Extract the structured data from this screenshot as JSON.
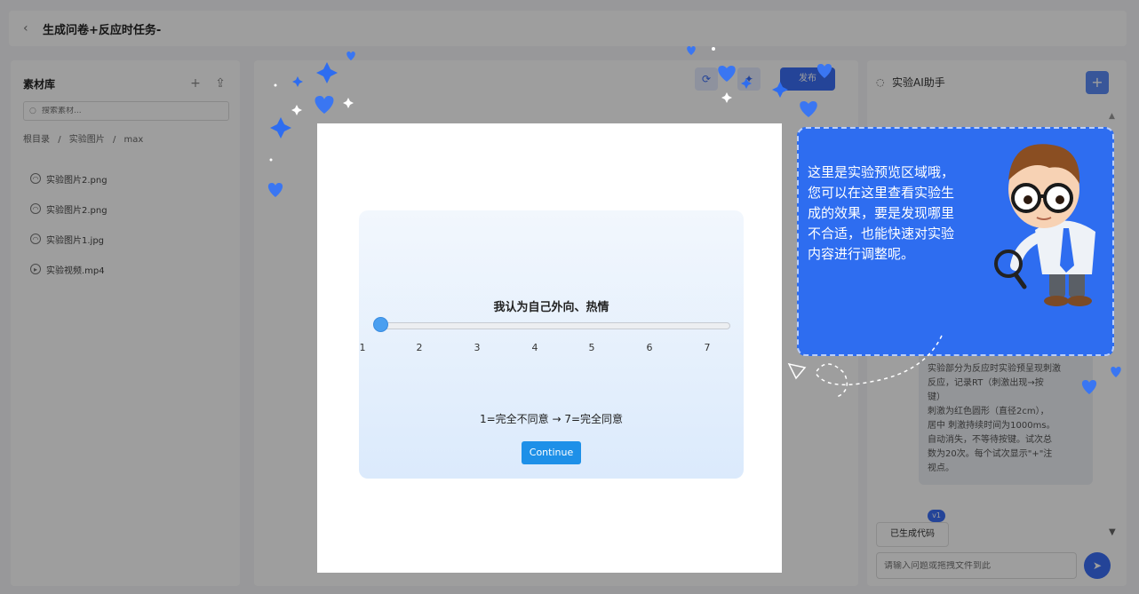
{
  "header": {
    "title": "生成问卷+反应时任务-"
  },
  "left_panel": {
    "title": "素材库",
    "search_placeholder": "搜索素材...",
    "breadcrumb": [
      "根目录",
      "/",
      "实验图片",
      "/",
      "max"
    ],
    "files": [
      {
        "name": "实验图片2.png",
        "icon": "image-icon"
      },
      {
        "name": "实验图片2.png",
        "icon": "image-icon"
      },
      {
        "name": "实验图片1.jpg",
        "icon": "image-icon"
      },
      {
        "name": "实验视频.mp4",
        "icon": "video-icon"
      }
    ]
  },
  "toolbar": {
    "publish_label": "发布"
  },
  "right_panel": {
    "title": "实验AI助手",
    "message_lines": [
      "实验部分为反应时实验预呈现刺激",
      "反应，记录RT（刺激出现→按",
      "键）",
      "刺激为红色圆形（直径2cm），",
      "居中 刺激持续时间为1000ms。",
      "自动消失，不等待按键。试次总",
      "数为20次。每个试次显示\"+\"注",
      "视点。"
    ],
    "code_tag": "已生成代码",
    "code_badge": "v1",
    "input_placeholder": "请输入问题或拖拽文件到此"
  },
  "survey": {
    "question": "我认为自己外向、热情",
    "ticks": [
      "1",
      "2",
      "3",
      "4",
      "5",
      "6",
      "7"
    ],
    "scale_note": "1=完全不同意 → 7=完全同意",
    "continue_label": "Continue"
  },
  "tooltip": {
    "lines": [
      "这里是实验预览区域哦，",
      "您可以在这里查看实验生",
      "成的效果，要是发现哪里",
      "不合适，也能快速对实验",
      "内容进行调整呢。"
    ]
  },
  "colors": {
    "accent": "#2e6df0",
    "button": "#1e90e8",
    "slider": "#4a9ff0"
  }
}
